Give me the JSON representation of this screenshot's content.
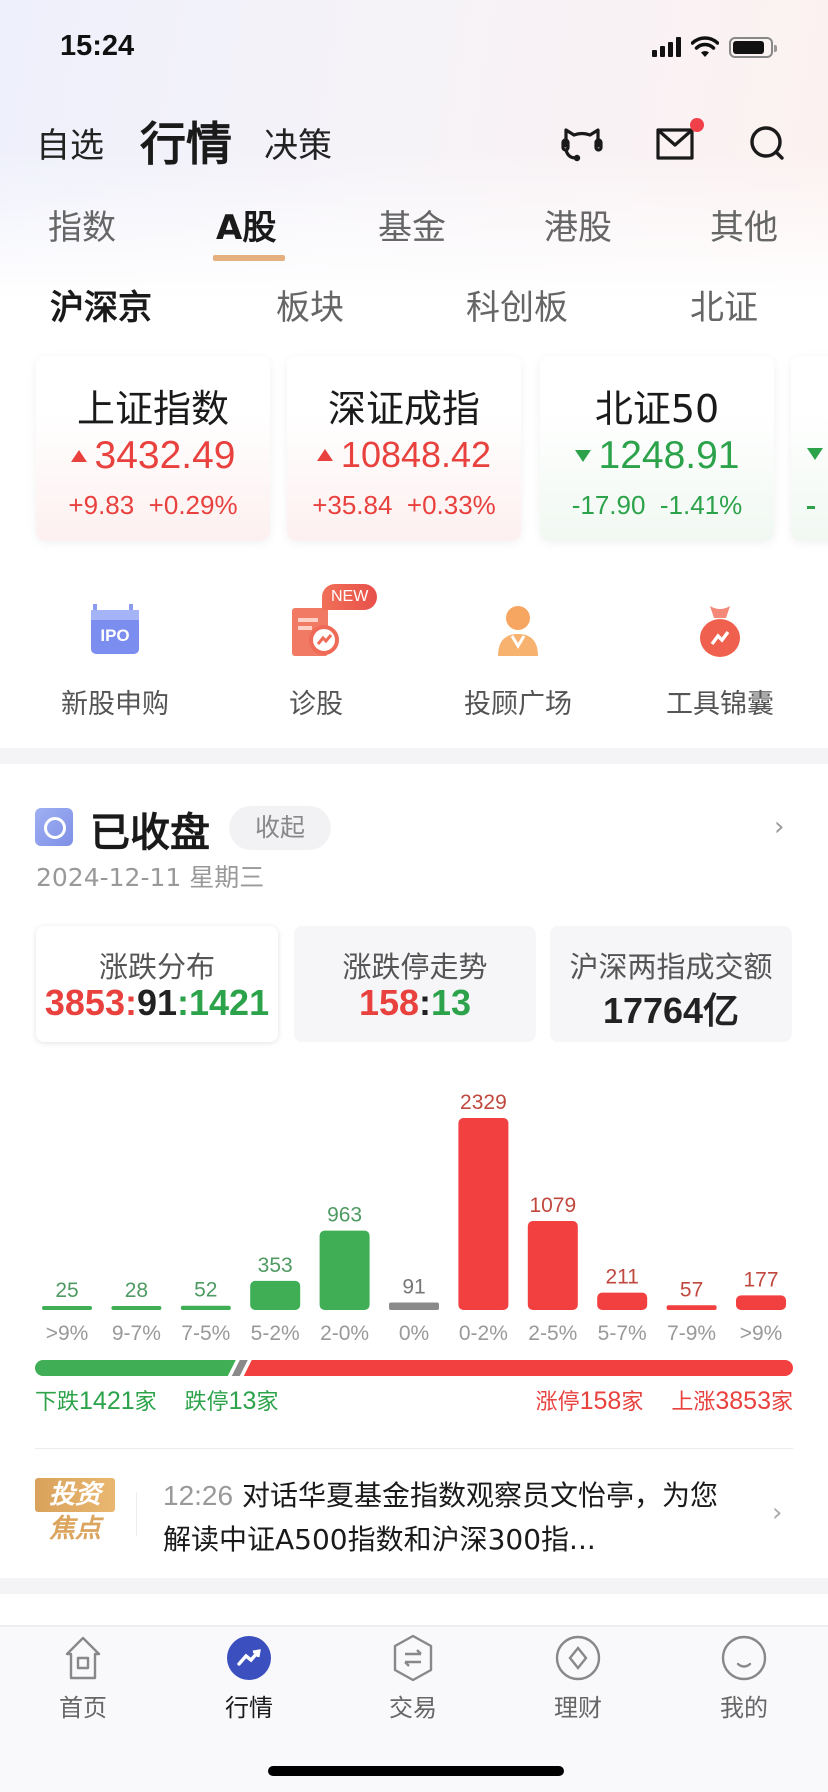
{
  "status_bar": {
    "time": "15:24"
  },
  "header": {
    "tabs": [
      {
        "label": "自选",
        "active": false
      },
      {
        "label": "行情",
        "active": true
      },
      {
        "label": "决策",
        "active": false
      }
    ],
    "icons": [
      "customer-service-icon",
      "mail-icon",
      "search-icon"
    ],
    "mail_has_notification": true
  },
  "category_tabs": [
    {
      "label": "指数",
      "active": false
    },
    {
      "label": "A股",
      "active": true
    },
    {
      "label": "基金",
      "active": false
    },
    {
      "label": "港股",
      "active": false
    },
    {
      "label": "其他",
      "active": false
    }
  ],
  "sub_tabs": [
    {
      "label": "沪深京",
      "active": true
    },
    {
      "label": "板块",
      "active": false
    },
    {
      "label": "科创板",
      "active": false
    },
    {
      "label": "北证",
      "active": false
    }
  ],
  "indices": [
    {
      "name": "上证指数",
      "value": "3432.49",
      "change": "+9.83",
      "change_pct": "+0.29%",
      "direction": "up"
    },
    {
      "name": "深证成指",
      "value": "10848.42",
      "change": "+35.84",
      "change_pct": "+0.33%",
      "direction": "up"
    },
    {
      "name": "北证50",
      "value": "1248.91",
      "change": "-17.90",
      "change_pct": "-1.41%",
      "direction": "down"
    }
  ],
  "shortcuts": [
    {
      "label": "新股申购",
      "icon": "ipo-calendar-icon",
      "icon_text": "IPO"
    },
    {
      "label": "诊股",
      "icon": "stock-diagnosis-icon",
      "badge": "NEW"
    },
    {
      "label": "投顾广场",
      "icon": "advisor-icon"
    },
    {
      "label": "工具锦囊",
      "icon": "toolbag-icon"
    }
  ],
  "market_status": {
    "title": "已收盘",
    "collapse_label": "收起",
    "date": "2024-12-11 星期三"
  },
  "stat_cards": [
    {
      "label": "涨跌分布",
      "up": "3853",
      "flat": "91",
      "down": "1421",
      "active": true
    },
    {
      "label": "涨跌停走势",
      "up": "158",
      "down": "13",
      "active": false
    },
    {
      "label": "沪深两指成交额",
      "value": "17764亿",
      "active": false
    }
  ],
  "colors": {
    "up": "#f23f3f",
    "down": "#3fae55",
    "flat": "#8a8a8a",
    "accent": "#e3b07e",
    "brand": "#3a4fc4"
  },
  "chart_data": {
    "type": "bar",
    "title": "涨跌分布",
    "categories": [
      ">9%",
      "9-7%",
      "7-5%",
      "5-2%",
      "2-0%",
      "0%",
      "0-2%",
      "2-5%",
      "5-7%",
      "7-9%",
      ">9%"
    ],
    "values": [
      25,
      28,
      52,
      353,
      963,
      91,
      2329,
      1079,
      211,
      57,
      177
    ],
    "directions": [
      "down",
      "down",
      "down",
      "down",
      "down",
      "flat",
      "up",
      "up",
      "up",
      "up",
      "up"
    ],
    "xlabel": "",
    "ylabel": "",
    "ylim": [
      0,
      2329
    ],
    "grid": false
  },
  "ratio_bar": {
    "down_total": 1421,
    "flat_total": 91,
    "up_total": 3853,
    "legend_left": [
      {
        "prefix": "下跌",
        "count": "1421",
        "suffix": "家"
      },
      {
        "prefix": "跌停",
        "count": "13",
        "suffix": "家"
      }
    ],
    "legend_right": [
      {
        "prefix": "涨停",
        "count": "158",
        "suffix": "家"
      },
      {
        "prefix": "上涨",
        "count": "3853",
        "suffix": "家"
      }
    ]
  },
  "news": {
    "logo_top": "投资",
    "logo_bottom": "焦点",
    "time": "12:26",
    "headline": "对话华夏基金指数观察员文怡亭，为您解读中证A500指数和沪深300指..."
  },
  "bottom_nav": [
    {
      "label": "首页",
      "icon": "home-icon",
      "active": false
    },
    {
      "label": "行情",
      "icon": "market-trend-icon",
      "active": true
    },
    {
      "label": "交易",
      "icon": "trade-exchange-icon",
      "active": false
    },
    {
      "label": "理财",
      "icon": "wealth-icon",
      "active": false
    },
    {
      "label": "我的",
      "icon": "profile-icon",
      "active": false
    }
  ]
}
